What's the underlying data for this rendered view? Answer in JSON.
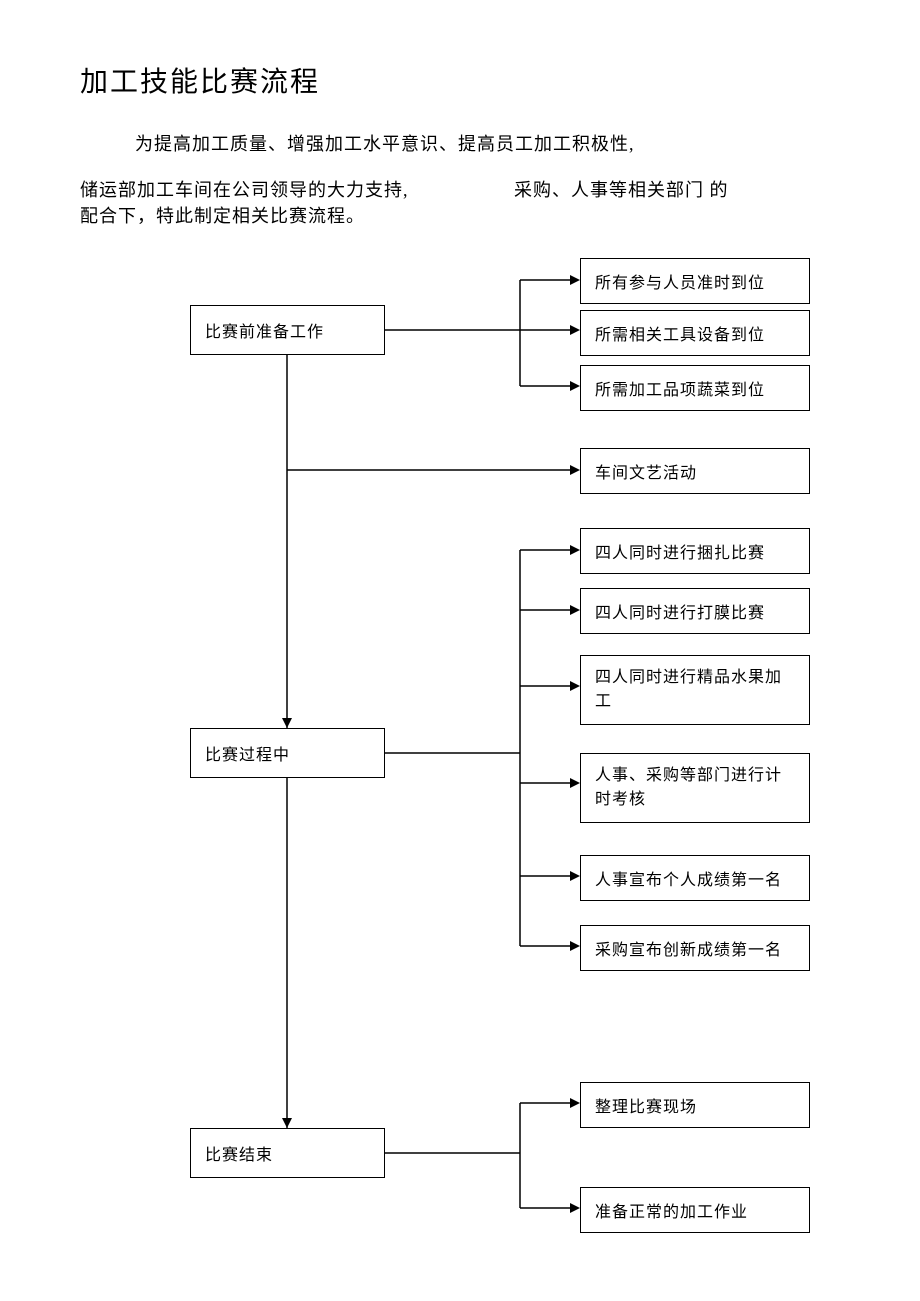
{
  "title": "加工技能比赛流程",
  "intro1": "为提高加工质量、增强加工水平意识、提高员工加工积极性,",
  "intro2a": "储运部加工车间在公司领导的大力支持,",
  "intro2b": "采购、人事等相关部门 的",
  "intro2c": "配合下，特此制定相关比赛流程。",
  "stages": {
    "prep": {
      "label": "比赛前准备工作",
      "items": [
        "所有参与人员准时到位",
        "所需相关工具设备到位",
        "所需加工品项蔬菜到位"
      ]
    },
    "activity": {
      "items": [
        "车间文艺活动"
      ]
    },
    "during": {
      "label": "比赛过程中",
      "items": [
        "四人同时进行捆扎比赛",
        "四人同时进行打膜比赛",
        "四人同时进行精品水果加工",
        "人事、采购等部门进行计时考核",
        "人事宣布个人成绩第一名",
        "采购宣布创新成绩第一名"
      ]
    },
    "end": {
      "label": "比赛结束",
      "items": [
        "整理比赛现场",
        "准备正常的加工作业"
      ]
    }
  }
}
